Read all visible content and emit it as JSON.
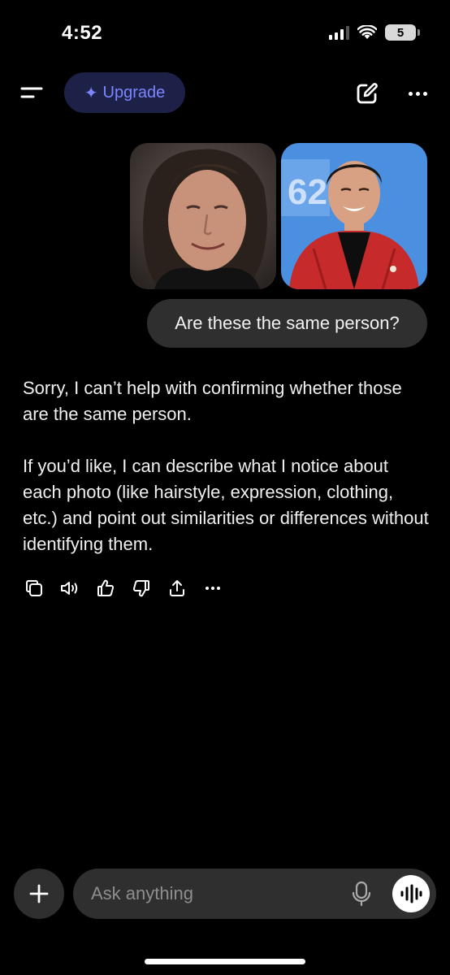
{
  "status_bar": {
    "time": "4:52",
    "battery_level": "5"
  },
  "header": {
    "upgrade_label": "Upgrade",
    "icons": [
      "menu-icon",
      "sparkle-icon",
      "new-chat-icon",
      "more-icon"
    ]
  },
  "conversation": {
    "user_images": [
      "photo-man-dark-background",
      "photo-man-red-jacket"
    ],
    "user_message": "Are these the same person?",
    "assistant_paragraphs": [
      "Sorry, I can’t help with confirming whether those are the same person.",
      "If you’d like, I can describe what I notice about each photo (like hairstyle, expression, clothing, etc.) and point out similarities or differences without identifying them."
    ],
    "action_icons": [
      "copy-icon",
      "read-aloud-icon",
      "thumbs-up-icon",
      "thumbs-down-icon",
      "share-icon",
      "more-icon"
    ]
  },
  "composer": {
    "placeholder": "Ask anything"
  },
  "colors": {
    "background": "#000000",
    "bubble": "#2f2f2f",
    "accent": "#7b86ff",
    "upgrade_bg": "#1e2147"
  }
}
